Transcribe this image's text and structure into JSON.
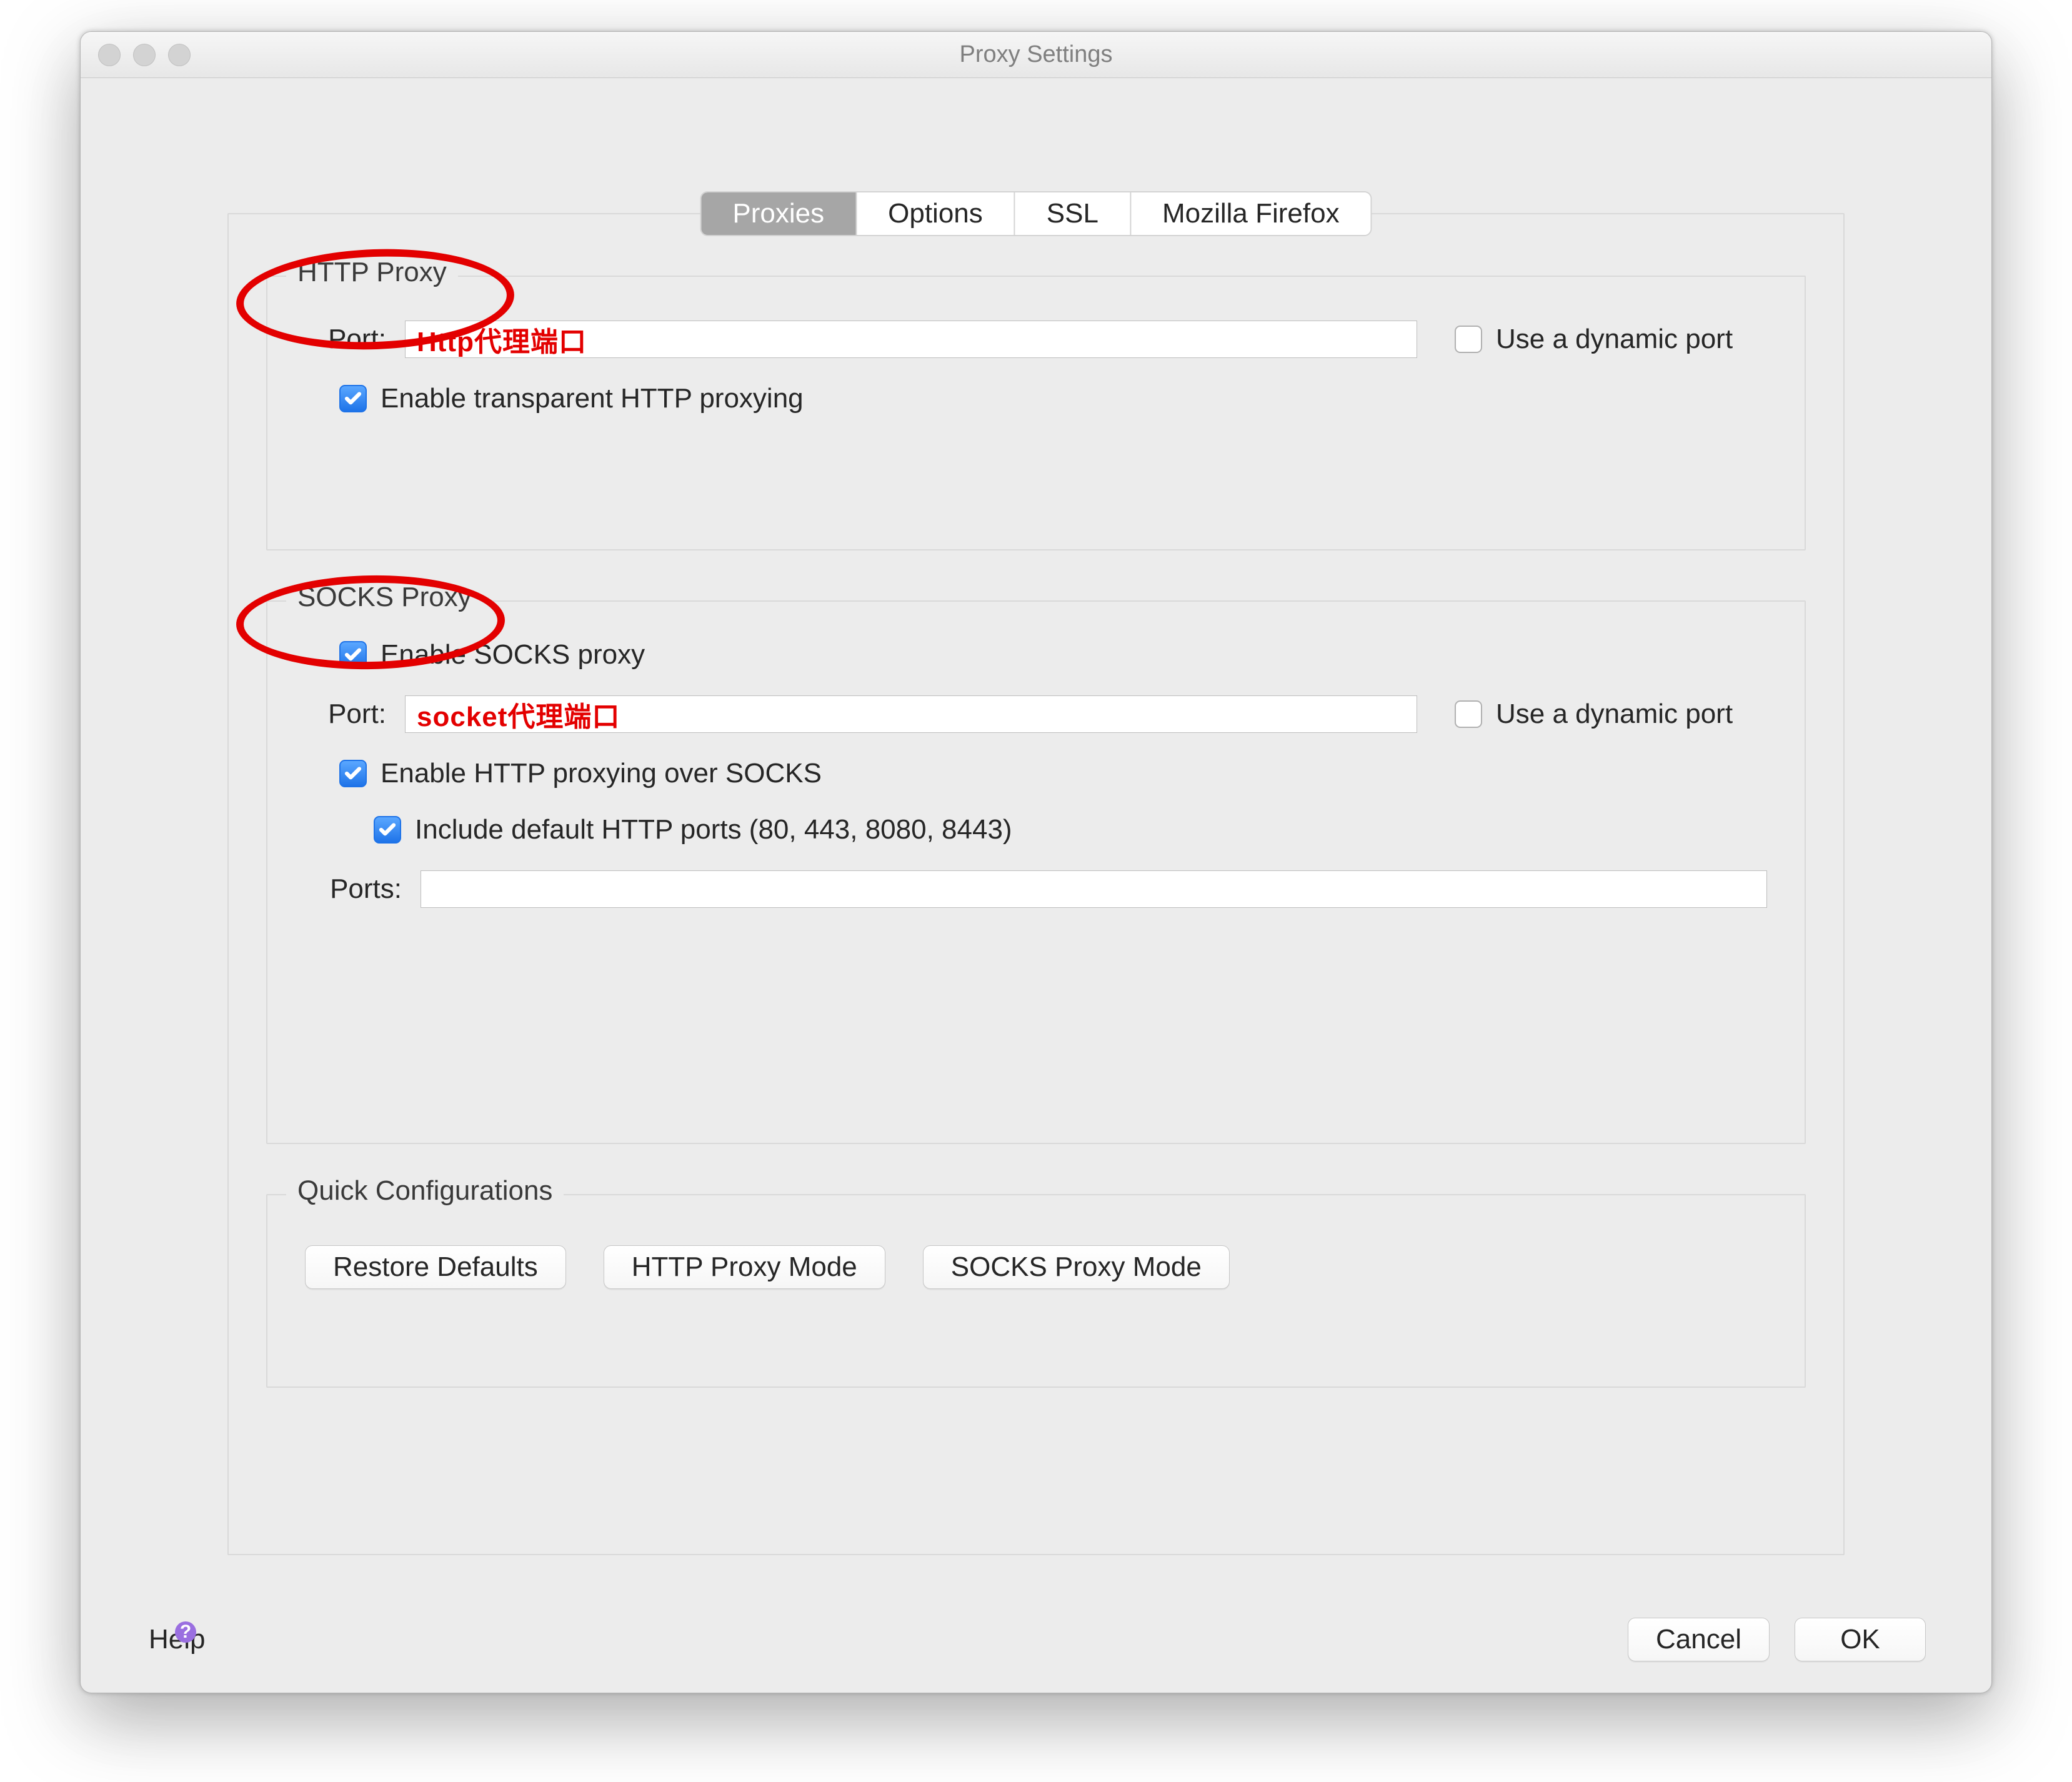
{
  "window": {
    "title": "Proxy Settings"
  },
  "tabs": {
    "proxies": "Proxies",
    "options": "Options",
    "ssl": "SSL",
    "mozilla": "Mozilla Firefox"
  },
  "httpProxy": {
    "legend": "HTTP Proxy",
    "portLabel": "Port:",
    "portValue": "Http代理端口",
    "dynamicLabel": "Use a dynamic port",
    "dynamicChecked": false,
    "transparentLabel": "Enable transparent HTTP proxying",
    "transparentChecked": true
  },
  "socksProxy": {
    "legend": "SOCKS Proxy",
    "enableLabel": "Enable SOCKS proxy",
    "enableChecked": true,
    "portLabel": "Port:",
    "portValue": "socket代理端口",
    "dynamicLabel": "Use a dynamic port",
    "dynamicChecked": false,
    "httpOverSocksLabel": "Enable HTTP proxying over SOCKS",
    "httpOverSocksChecked": true,
    "includeDefaultLabel": "Include default HTTP ports (80, 443, 8080, 8443)",
    "includeDefaultChecked": true,
    "portsLabel": "Ports:",
    "portsValue": ""
  },
  "quick": {
    "legend": "Quick Configurations",
    "restore": "Restore Defaults",
    "httpMode": "HTTP Proxy Mode",
    "socksMode": "SOCKS Proxy Mode"
  },
  "footer": {
    "help": "Help",
    "cancel": "Cancel",
    "ok": "OK"
  }
}
